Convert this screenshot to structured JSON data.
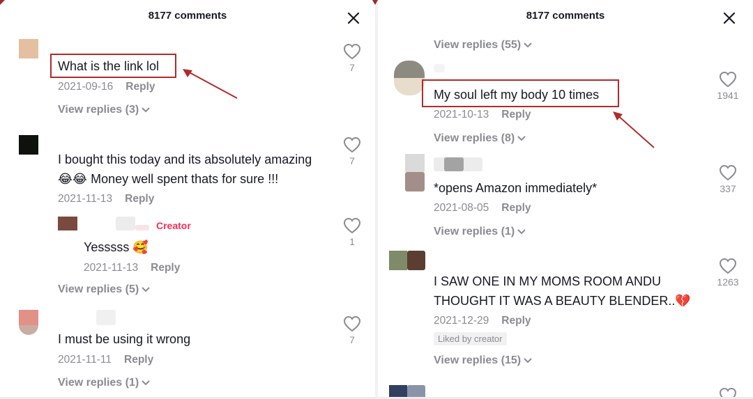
{
  "left": {
    "title": "8177 comments",
    "comments": [
      {
        "text": "What is the link lol",
        "date": "2021-09-16",
        "reply": "Reply",
        "likes": "7",
        "view_replies": "View replies (3)"
      },
      {
        "text_line1": "I bought this today and its absolutely amazing",
        "emoji_line2": "😂😂",
        "text_line2": " Money well spent thats for sure !!!",
        "date": "2021-11-13",
        "reply": "Reply",
        "likes": "7"
      },
      {
        "creator_label": "Creator",
        "text": "Yesssss",
        "emoji": "🥰",
        "date": "2021-11-13",
        "reply": "Reply",
        "likes": "1",
        "view_replies": "View replies (5)"
      },
      {
        "text": "I must be using it wrong",
        "date": "2021-11-11",
        "reply": "Reply",
        "likes": "7",
        "view_replies": "View replies (1)"
      }
    ]
  },
  "right": {
    "title": "8177 comments",
    "top_view_replies": "View replies (55)",
    "comments": [
      {
        "text": "My soul left my body 10 times",
        "date": "2021-10-13",
        "reply": "Reply",
        "likes": "1941",
        "view_replies": "View replies (8)"
      },
      {
        "text": "*opens Amazon immediately*",
        "date": "2021-08-05",
        "reply": "Reply",
        "likes": "337",
        "view_replies": "View replies (1)"
      },
      {
        "text_line1": "I SAW ONE IN MY MOMS ROOM ANDU",
        "text_line2": "THOUGHT IT WAS A BEAUTY BLENDER..",
        "emoji": "💔",
        "date": "2021-12-29",
        "reply": "Reply",
        "likes": "1263",
        "liked_by": "Liked by creator",
        "view_replies": "View replies (15)"
      }
    ]
  },
  "colors": {
    "accent": "#fe2c55",
    "highlight": "#b22a2a",
    "muted": "#8a8b91"
  },
  "icons": [
    "close-icon",
    "heart-icon",
    "chevron-down-icon",
    "arrow-icon"
  ]
}
